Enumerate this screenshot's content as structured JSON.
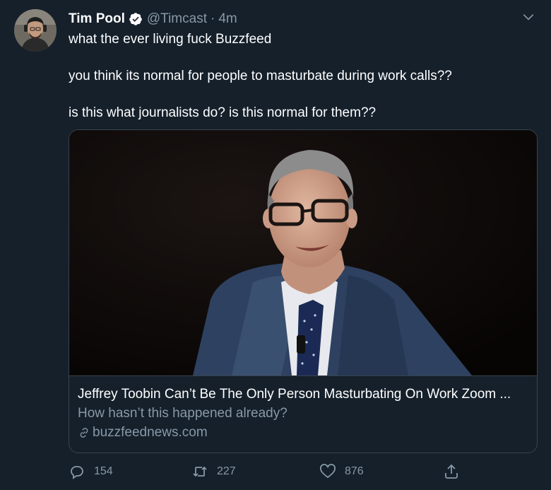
{
  "tweet": {
    "author_name": "Tim Pool",
    "handle": "@Timcast",
    "separator": "·",
    "time": "4m",
    "lines": [
      "what the ever living fuck Buzzfeed",
      "you think its normal for people to masturbate during work calls??",
      "is this what journalists do? is this normal for them??"
    ]
  },
  "card": {
    "title": "Jeffrey Toobin Can’t Be The Only Person Masturbating On Work Zoom ...",
    "description": "How hasn’t this happened already?",
    "domain": "buzzfeednews.com"
  },
  "actions": {
    "reply_count": "154",
    "retweet_count": "227",
    "like_count": "876"
  },
  "icons": {
    "verified": "verified-badge-icon",
    "caret": "chevron-down-icon",
    "link": "link-icon",
    "reply": "reply-icon",
    "retweet": "retweet-icon",
    "like": "heart-icon",
    "share": "share-icon"
  },
  "colors": {
    "background": "#15202b",
    "secondary_text": "#8899a6",
    "verified": "#1da1f2",
    "border": "#38444d"
  }
}
